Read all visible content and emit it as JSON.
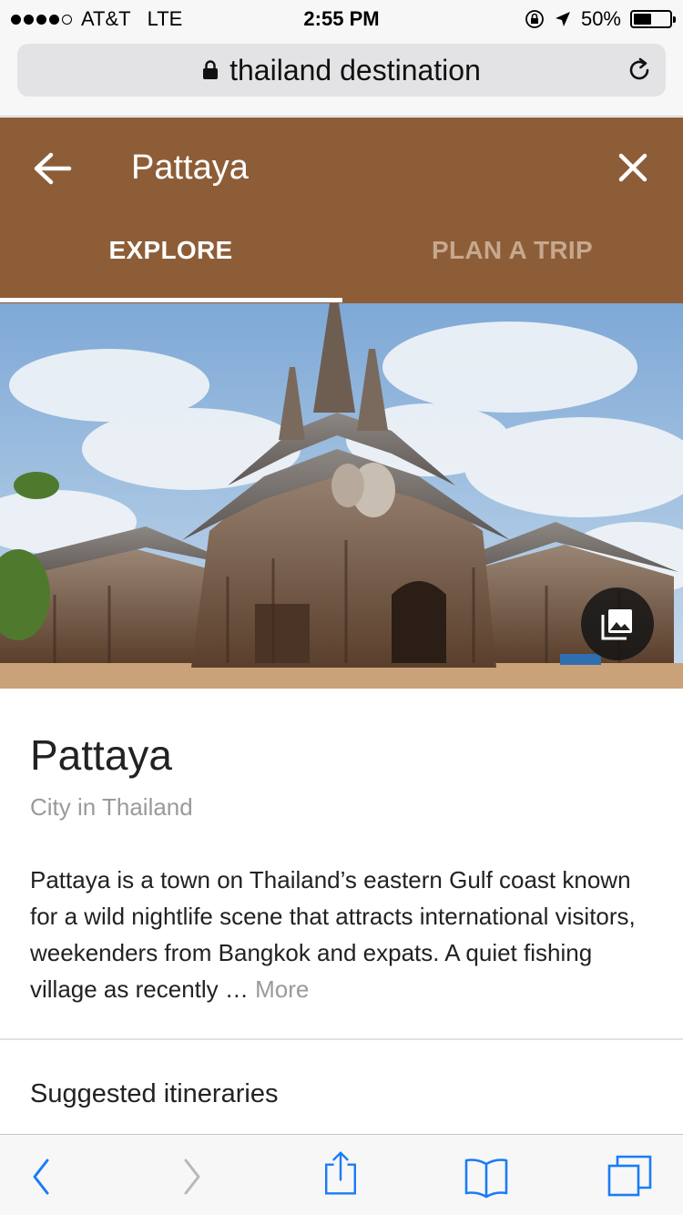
{
  "status_bar": {
    "carrier": "AT&T",
    "network": "LTE",
    "time": "2:55 PM",
    "battery_percent": "50%",
    "battery_level": 0.5,
    "signal_bars": 4,
    "signal_max": 5
  },
  "browser": {
    "url_text": "thailand destination",
    "icons": [
      "lock-icon",
      "reload-icon"
    ]
  },
  "header": {
    "title": "Pattaya",
    "back_icon": "arrow-left-icon",
    "close_icon": "close-icon",
    "background_color": "#8d5d38",
    "tabs": [
      {
        "label": "EXPLORE",
        "active": true
      },
      {
        "label": "PLAN A TRIP",
        "active": false
      }
    ]
  },
  "hero": {
    "gallery_icon": "photo-gallery-icon"
  },
  "place": {
    "title": "Pattaya",
    "subtitle": "City in Thailand",
    "description": "Pattaya is a town on Thailand’s eastern Gulf coast known for a wild nightlife scene that attracts international visitors, weekenders from Bangkok and expats. A quiet fishing village as recently …",
    "more_label": "More"
  },
  "sections": {
    "suggested_itineraries": "Suggested itineraries"
  },
  "toolbar": {
    "icons": [
      "back-icon",
      "forward-icon",
      "share-icon",
      "bookmarks-icon",
      "tabs-icon"
    ],
    "accent_color": "#1a7cf5"
  }
}
